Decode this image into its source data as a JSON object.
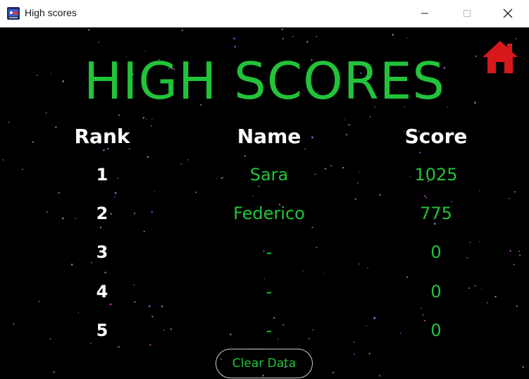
{
  "window": {
    "title": "High scores"
  },
  "heading": "HIGH SCORES",
  "columns": {
    "rank": "Rank",
    "name": "Name",
    "score": "Score"
  },
  "rows": [
    {
      "rank": "1",
      "name": "Sara",
      "score": "1025"
    },
    {
      "rank": "2",
      "name": "Federico",
      "score": "775"
    },
    {
      "rank": "3",
      "name": "-",
      "score": "0"
    },
    {
      "rank": "4",
      "name": "-",
      "score": "0"
    },
    {
      "rank": "5",
      "name": "-",
      "score": "0"
    }
  ],
  "buttons": {
    "clear": "Clear Data"
  },
  "colors": {
    "accent": "#22c33a",
    "home": "#d7191c",
    "background": "#000000"
  },
  "icons": {
    "home": "home-icon",
    "app": "app-icon"
  }
}
